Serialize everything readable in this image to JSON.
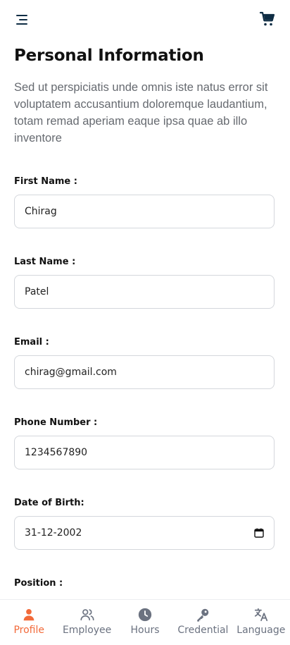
{
  "header": {
    "menu_icon": "hamburger-menu-icon",
    "cart_icon": "shopping-cart-icon"
  },
  "page": {
    "title": "Personal Information",
    "description": "Sed ut perspiciatis unde omnis iste natus error sit voluptatem accusantium doloremque laudantium, totam remad aperiam eaque ipsa quae ab illo inventore"
  },
  "form": {
    "first_name": {
      "label": "First Name :",
      "value": "Chirag"
    },
    "last_name": {
      "label": "Last Name :",
      "value": "Patel"
    },
    "email": {
      "label": "Email :",
      "value": "chirag@gmail.com"
    },
    "phone": {
      "label": "Phone Number :",
      "value": "1234567890"
    },
    "dob": {
      "label": "Date of Birth:",
      "value": "31-12-2002"
    },
    "position": {
      "label": "Position :"
    }
  },
  "nav": {
    "active": "Profile",
    "items": [
      {
        "label": "Profile",
        "icon": "person-icon"
      },
      {
        "label": "Employee",
        "icon": "people-icon"
      },
      {
        "label": "Hours",
        "icon": "clock-icon"
      },
      {
        "label": "Credential",
        "icon": "key-icon"
      },
      {
        "label": "Language",
        "icon": "translate-icon"
      }
    ]
  },
  "colors": {
    "accent": "#f26a3a",
    "cart": "#0f2d44",
    "inactive": "#6b7280",
    "border": "#d4d7dc"
  }
}
